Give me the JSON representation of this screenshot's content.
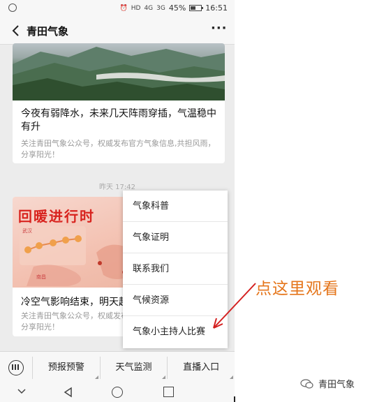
{
  "status_bar": {
    "battery": "45%",
    "time": "16:51",
    "network_left": "4G",
    "network_right": "3G"
  },
  "header": {
    "title": "青田气象"
  },
  "articles": [
    {
      "title": "今夜有弱降水，未来几天阵雨穿插，气温稳中有升",
      "description": "关注青田气象公众号，权威发布官方气象信息,共担风雨，分享阳光！"
    },
    {
      "title": "冷空气影响结束，明天起",
      "description": "关注青田气象公众号，权威发布官方气象信息,共担风雨，分享阳光！",
      "banner": "回暖进行时",
      "map_labels": [
        "武汉",
        "南昌"
      ]
    }
  ],
  "timestamp": "昨天 17:42",
  "popup_menu": {
    "items": [
      "气象科普",
      "气象证明",
      "联系我们",
      "气候资源",
      "气象小主持人比赛"
    ]
  },
  "bottom_menu": {
    "items": [
      "预报预警",
      "天气监测",
      "直播入口"
    ]
  },
  "annotation": {
    "text": "点这里观看"
  },
  "watermark": {
    "text": "青田气象"
  },
  "colors": {
    "annotation": "#e5761c",
    "arrow": "#d42020",
    "banner_red": "#d8231e"
  }
}
